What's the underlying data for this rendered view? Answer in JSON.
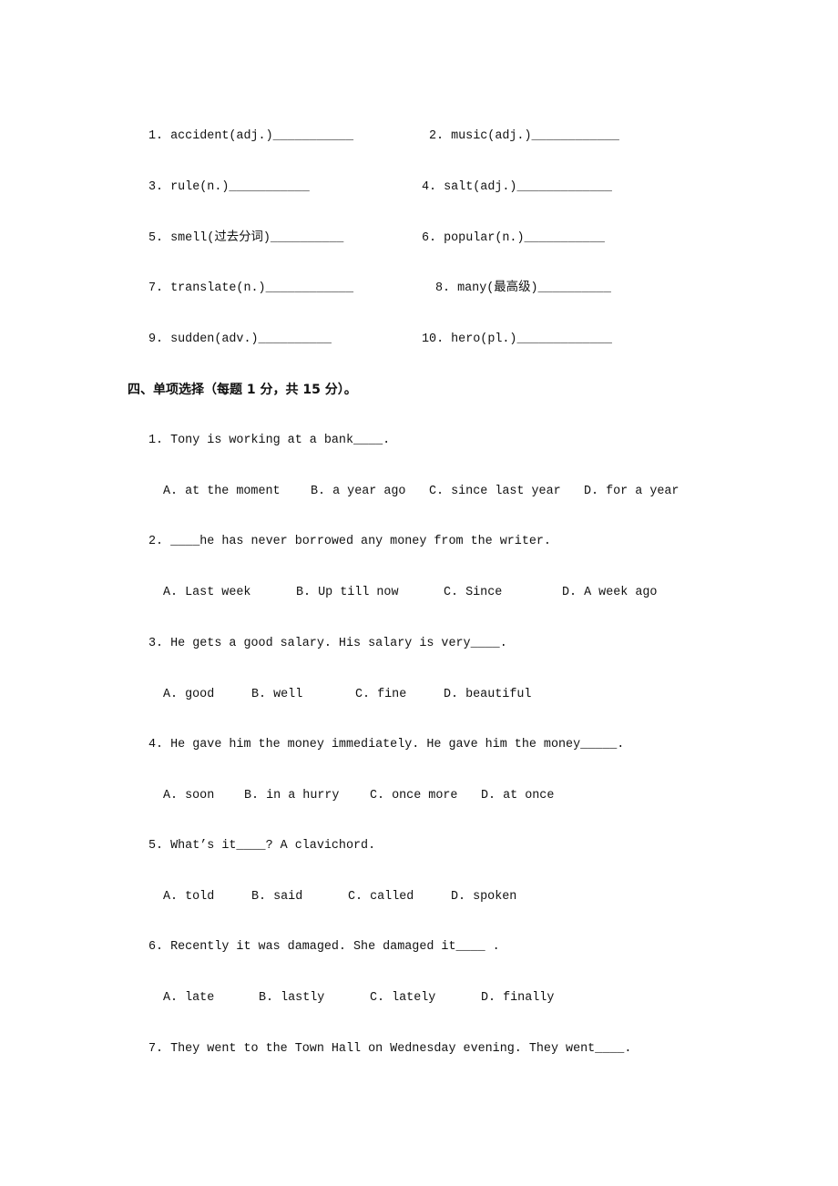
{
  "word_forms": [
    {
      "text": "1. accident(adj.)",
      "blank": "___________"
    },
    {
      "text": "2. music(adj.)",
      "blank": "____________"
    },
    {
      "text": "3. rule(n.)",
      "blank": "___________"
    },
    {
      "text": "4. salt(adj.)",
      "blank": "_____________"
    },
    {
      "text": "5. smell(过去分词)",
      "blank": "__________"
    },
    {
      "text": "6. popular(n.)",
      "blank": "___________"
    },
    {
      "text": "7. translate(n.)",
      "blank": "____________"
    },
    {
      "text": "8. many(最高级)",
      "blank": "__________"
    },
    {
      "text": "9. sudden(adv.)",
      "blank": "__________"
    },
    {
      "text": "10. hero(pl.)",
      "blank": "_____________"
    }
  ],
  "section_title": "四、单项选择（每题 1 分，共 15 分）。",
  "questions": [
    {
      "q": "1. Tony is working at a bank____.",
      "options": [
        "A. at the moment",
        "B. a year ago",
        "C. since last year",
        "D. for a year"
      ]
    },
    {
      "q": "2. ____he has never borrowed any money from the writer.",
      "options": [
        "A. Last week",
        "B. Up till now",
        "C. Since",
        "D. A week ago"
      ]
    },
    {
      "q": "3. He gets a good salary. His salary is very____.",
      "options": [
        "A. good",
        "B. well",
        "C. fine",
        "D. beautiful"
      ]
    },
    {
      "q": "4. He gave him the money immediately. He gave him the money_____.",
      "options": [
        "A. soon",
        "B. in a hurry",
        "C. once more",
        "D. at once"
      ]
    },
    {
      "q": "5. What’s it____? A clavichord.",
      "options": [
        "A. told",
        "B. said",
        "C. called",
        "D. spoken"
      ]
    },
    {
      "q": "6. Recently it was damaged. She damaged it____ .",
      "options": [
        "A. late",
        "B. lastly",
        "C. lately",
        "D. finally"
      ]
    },
    {
      "q": "7. They went to the Town Hall on Wednesday evening. They went____.",
      "options": []
    }
  ]
}
